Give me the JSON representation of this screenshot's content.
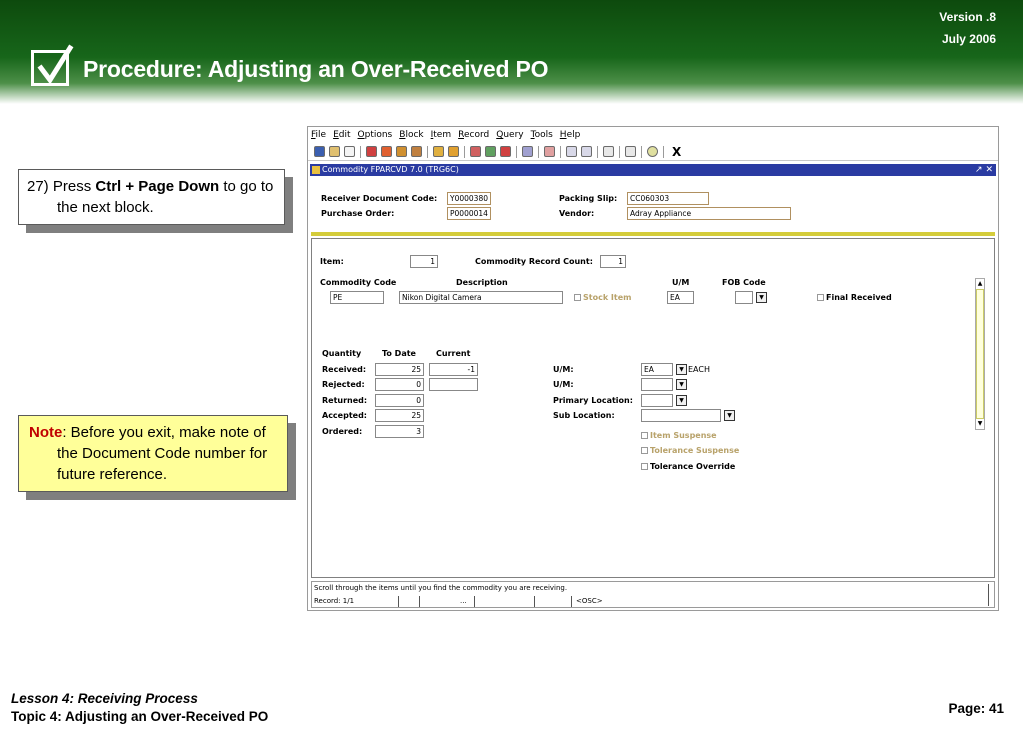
{
  "header": {
    "version": "Version .8",
    "date": "July  2006",
    "title": "Procedure:  Adjusting an Over-Received PO"
  },
  "step": {
    "number": "27)",
    "text_before": "Press ",
    "bold": "Ctrl + Page Down",
    "text_after": " to go to the next block."
  },
  "note": {
    "label": "Note",
    "text": ": Before you exit, make note of the Document Code number for future reference."
  },
  "app": {
    "menu": [
      "File",
      "Edit",
      "Options",
      "Block",
      "Item",
      "Record",
      "Query",
      "Tools",
      "Help"
    ],
    "toolbar_close": "X",
    "window_title": "Commodity  FPARCVD  7.0  (TRG6C)",
    "window_controls": "↗ ✕",
    "key_block": {
      "receiver_doc_label": "Receiver Document Code:",
      "receiver_doc_value": "Y0000380",
      "packing_slip_label": "Packing Slip:",
      "packing_slip_value": "CC060303",
      "po_label": "Purchase Order:",
      "po_value": "P0000014",
      "vendor_label": "Vendor:",
      "vendor_value": "Adray Appliance"
    },
    "item_block": {
      "item_label": "Item:",
      "item_value": "1",
      "record_count_label": "Commodity Record Count:",
      "record_count_value": "1",
      "col_commodity": "Commodity Code",
      "col_description": "Description",
      "col_um": "U/M",
      "col_fob": "FOB Code",
      "commodity_value": "PE",
      "description_value": "Nikon Digital Camera",
      "stock_item": "Stock Item",
      "um_value": "EA",
      "final_received": "Final Received"
    },
    "qty_block": {
      "col_quantity": "Quantity",
      "col_to_date": "To Date",
      "col_current": "Current",
      "rows": [
        {
          "label": "Received:",
          "to_date": "25",
          "current": "-1"
        },
        {
          "label": "Rejected:",
          "to_date": "0",
          "current": ""
        },
        {
          "label": "Returned:",
          "to_date": "0"
        },
        {
          "label": "Accepted:",
          "to_date": "25"
        },
        {
          "label": "Ordered:",
          "to_date": "3"
        }
      ],
      "um1_label": "U/M:",
      "um1_value": "EA",
      "um1_desc": "EACH",
      "um2_label": "U/M:",
      "primary_loc_label": "Primary Location:",
      "sub_loc_label": "Sub Location:",
      "item_suspense": "Item  Suspense",
      "tolerance_suspense": "Tolerance Suspense",
      "tolerance_override": "Tolerance Override"
    },
    "status": {
      "message": "Scroll through the items until you find the commodity you are receiving.",
      "record": "Record: 1/1",
      "ellipsis": "...",
      "osc": "<OSC>"
    }
  },
  "footer": {
    "lesson": "Lesson 4: Receiving Process",
    "topic": "Topic 4: Adjusting an Over-Received PO",
    "page": "Page: 41"
  },
  "colors": {
    "header_green": "#17661a",
    "banner_title_bar": "#2a3ba2",
    "note_background": "#ffff99",
    "note_label": "#c00000"
  }
}
